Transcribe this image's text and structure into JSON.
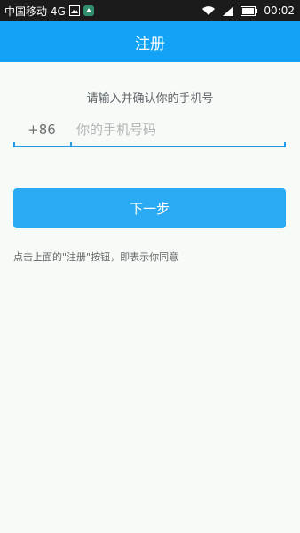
{
  "status_bar": {
    "carrier": "中国移动 4G",
    "time": "00:02"
  },
  "header": {
    "title": "注册"
  },
  "form": {
    "prompt": "请输入并确认你的手机号",
    "country_code": "+86",
    "phone_placeholder": "你的手机号码",
    "phone_value": ""
  },
  "next_button": {
    "label": "下一步"
  },
  "terms": {
    "text": "点击上面的\"注册\"按钮，即表示你同意"
  },
  "colors": {
    "header": "#12a3f6",
    "button": "#2aaaf2",
    "underline": "#1e9be9"
  }
}
